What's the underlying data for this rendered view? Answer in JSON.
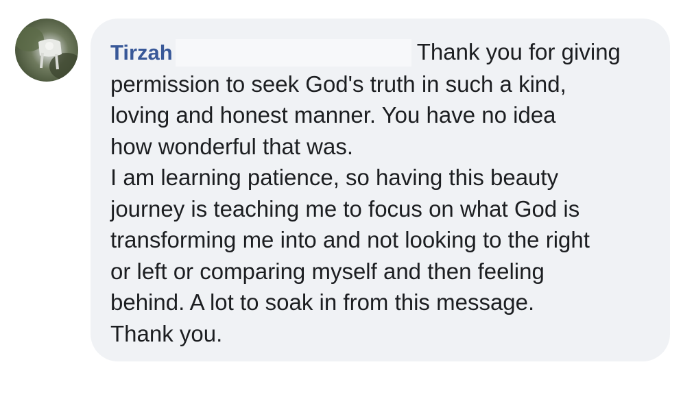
{
  "comment": {
    "author": "Tirzah",
    "first_line": "Thank you for giving",
    "body": "permission to seek God's truth in such a kind,\nloving and honest manner. You have no idea\nhow wonderful that was.\nI am learning patience, so having this beauty\njourney is teaching me to focus on what God is\ntransforming me into and not looking to the right\nor left or comparing myself and then feeling\nbehind. A lot to soak in from this message.\nThank you.",
    "avatar_icon": "profile-photo-avatar"
  }
}
